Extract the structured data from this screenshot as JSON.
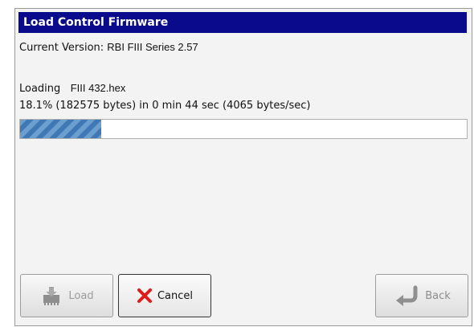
{
  "dialog": {
    "title": "Load Control Firmware",
    "current_version_label": "Current Version:",
    "current_version_value": "RBI FIII Series 2.57",
    "loading_label": "Loading",
    "loading_file": "FIII 432.hex",
    "progress_text": "18.1% (182575 bytes) in 0 min 44 sec (4065 bytes/sec)",
    "progress_fraction": 0.181
  },
  "buttons": {
    "load_label": "Load",
    "cancel_label": "Cancel",
    "back_label": "Back"
  },
  "colors": {
    "titlebar": "#0a0a8c",
    "cancel_x": "#e01b1b",
    "progress_fill": "#4f86c0"
  }
}
